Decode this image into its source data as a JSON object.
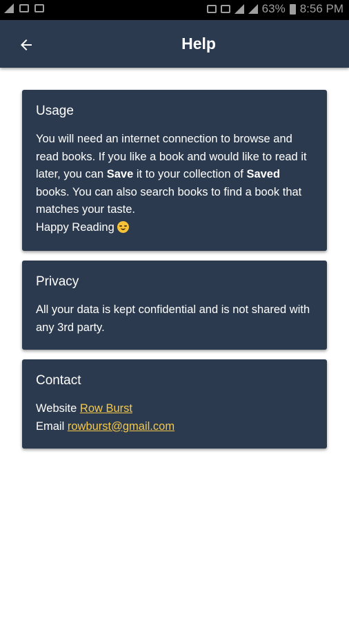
{
  "status_bar": {
    "left_icons": [
      "signal-2-icon",
      "image-icon",
      "message-icon"
    ],
    "battery": "63%",
    "time": "8:56 PM"
  },
  "app_bar": {
    "title": "Help",
    "back_icon": "arrow-left-icon"
  },
  "cards": {
    "usage": {
      "title": "Usage",
      "body_1": "You will need an internet connection to browse and read books. If you like a book and would like to read it later, you can ",
      "bold_1": "Save",
      "body_2": " it to your collection of ",
      "bold_2": "Saved",
      "body_3": " books. You can also search books to find a book that matches your taste.",
      "closing": "Happy Reading",
      "emoji": "smiling-face-icon"
    },
    "privacy": {
      "title": "Privacy",
      "body": "All your data is kept confidential and is not shared with any 3rd party."
    },
    "contact": {
      "title": "Contact",
      "website_label": "Website",
      "website_link": "Row Burst",
      "email_label": "Email",
      "email_link": "rowburst@gmail.com"
    }
  },
  "colors": {
    "primary": "#2b3a4e",
    "link": "#f7c948",
    "text": "#ffffff",
    "background": "#ffffff"
  }
}
